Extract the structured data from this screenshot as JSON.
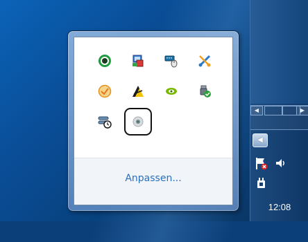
{
  "tray_popup": {
    "customize_label": "Anpassen...",
    "icons": [
      {
        "name": "green-ring-icon"
      },
      {
        "name": "graphics-display-icon"
      },
      {
        "name": "keyboard-mouse-icon"
      },
      {
        "name": "network-tool-icon"
      },
      {
        "name": "checklist-icon"
      },
      {
        "name": "yellow-triangle-icon"
      },
      {
        "name": "nvidia-icon"
      },
      {
        "name": "usb-safe-remove-icon"
      },
      {
        "name": "sync-clock-icon"
      },
      {
        "name": "grey-disc-icon"
      }
    ],
    "selected_icon": "grey-disc-icon"
  },
  "taskbar": {
    "clock_time": "12:08",
    "system_icons": [
      "action-center-flag-icon",
      "volume-icon",
      "power-plug-icon"
    ],
    "show_hidden_icons": "chevron-left-icon"
  }
}
